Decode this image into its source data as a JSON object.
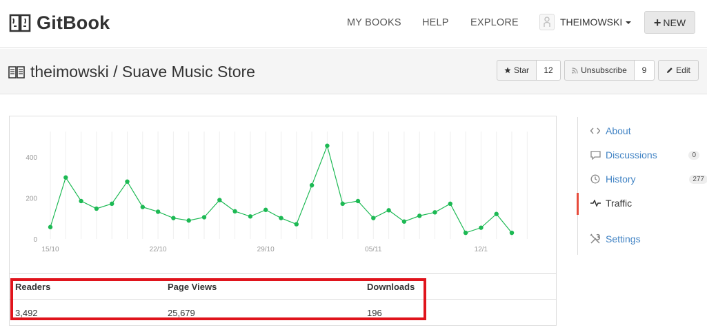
{
  "nav": {
    "logo_text": "GitBook",
    "links": [
      "MY BOOKS",
      "HELP",
      "EXPLORE"
    ],
    "username": "THEIMOWSKI",
    "new_label": "NEW"
  },
  "header": {
    "title": "theimowski / Suave Music Store",
    "star_label": "Star",
    "star_count": "12",
    "unsubscribe_label": "Unsubscribe",
    "subscriber_count": "9",
    "edit_label": "Edit"
  },
  "chart_data": {
    "type": "line",
    "x": [
      "15/10",
      "16/10",
      "17/10",
      "18/10",
      "19/10",
      "20/10",
      "21/10",
      "22/10",
      "23/10",
      "24/10",
      "25/10",
      "26/10",
      "27/10",
      "28/10",
      "29/10",
      "30/10",
      "31/10",
      "01/11",
      "02/11",
      "03/11",
      "04/11",
      "05/11",
      "06/11",
      "07/11",
      "08/11",
      "09/11",
      "10/11",
      "11/11",
      "12/11",
      "13/11",
      "14/11",
      "15/11"
    ],
    "values": [
      58,
      300,
      185,
      148,
      172,
      280,
      156,
      133,
      102,
      90,
      106,
      190,
      135,
      110,
      142,
      102,
      72,
      262,
      455,
      172,
      185,
      102,
      140,
      85,
      113,
      130,
      172,
      30,
      55,
      122,
      30
    ],
    "x_tick_labels": [
      "15/10",
      "22/10",
      "29/10",
      "05/11",
      "12/1"
    ],
    "y_tick_labels": [
      "0",
      "200",
      "400"
    ],
    "ylim": [
      0,
      500
    ],
    "grid": "vertical",
    "color": "#1db954"
  },
  "stats": {
    "readers_label": "Readers",
    "readers_value": "3,492",
    "pageviews_label": "Page Views",
    "pageviews_value": "25,679",
    "downloads_label": "Downloads",
    "downloads_value": "196"
  },
  "sidebar": {
    "about": "About",
    "discussions": "Discussions",
    "discussions_count": "0",
    "history": "History",
    "history_count": "277",
    "traffic": "Traffic",
    "settings": "Settings"
  }
}
